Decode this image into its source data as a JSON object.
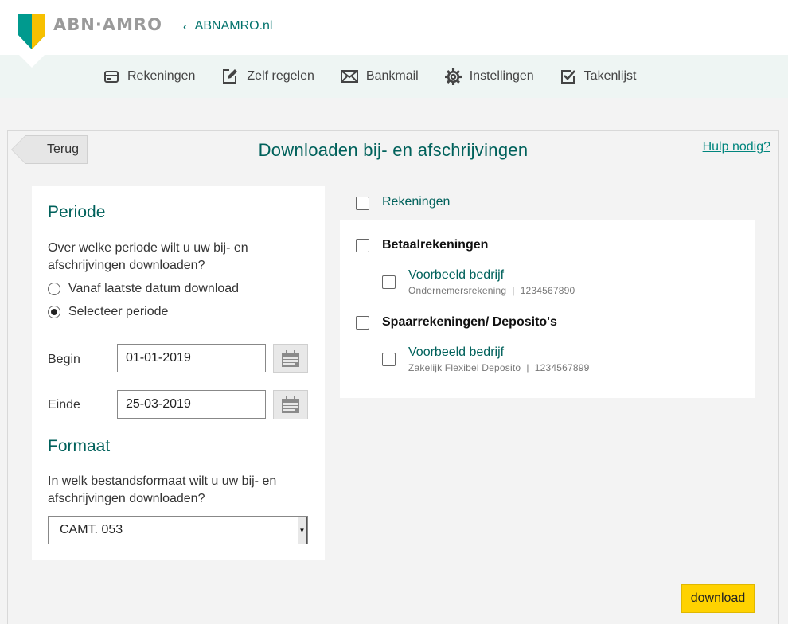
{
  "header": {
    "logo_text": "ABN·AMRO",
    "back_link": "ABNAMRO.nl"
  },
  "nav": {
    "items": [
      {
        "label": "Rekeningen",
        "icon": "wallet-icon"
      },
      {
        "label": "Zelf regelen",
        "icon": "edit-icon"
      },
      {
        "label": "Bankmail",
        "icon": "mail-icon"
      },
      {
        "label": "Instellingen",
        "icon": "gear-icon"
      },
      {
        "label": "Takenlijst",
        "icon": "checklist-icon"
      }
    ]
  },
  "panel": {
    "back_button": "Terug",
    "title": "Downloaden bij- en afschrijvingen",
    "help_link": "Hulp nodig?"
  },
  "periode": {
    "heading": "Periode",
    "question": "Over welke periode wilt u uw bij- en afschrijvingen downloaden?",
    "options": [
      {
        "label": "Vanaf laatste datum download",
        "selected": false
      },
      {
        "label": "Selecteer periode",
        "selected": true
      }
    ],
    "begin_label": "Begin",
    "begin_value": "01-01-2019",
    "einde_label": "Einde",
    "einde_value": "25-03-2019"
  },
  "formaat": {
    "heading": "Formaat",
    "question": "In welk bestandsformaat wilt u uw bij- en afschrijvingen downloaden?",
    "selected": "CAMT. 053"
  },
  "accounts": {
    "all_label": "Rekeningen",
    "groups": [
      {
        "label": "Betaalrekeningen",
        "accounts": [
          {
            "name": "Voorbeeld bedrijf",
            "type": "Ondernemersrekening",
            "sep": "|",
            "number": "1234567890"
          }
        ]
      },
      {
        "label": "Spaarrekeningen/ Deposito's",
        "accounts": [
          {
            "name": "Voorbeeld bedrijf",
            "type": "Zakelijk Flexibel Deposito",
            "sep": "|",
            "number": "1234567899"
          }
        ]
      }
    ]
  },
  "actions": {
    "download": "download"
  },
  "colors": {
    "brand_green": "#00615b",
    "brand_yellow": "#ffd200",
    "nav_background": "#eef5f3"
  }
}
